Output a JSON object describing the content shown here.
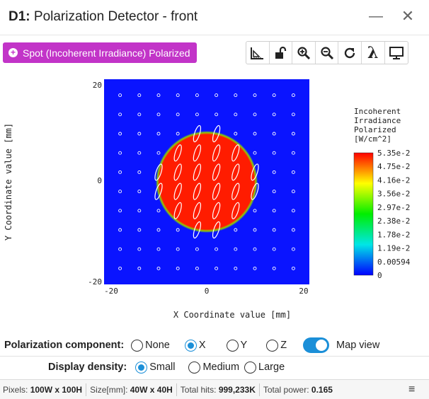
{
  "window": {
    "id": "D1:",
    "title": " Polarization Detector - front",
    "minimize_glyph": "—",
    "close_glyph": "✕"
  },
  "source_button": {
    "label": "Spot (Incoherent Irradiance) Polarized",
    "icon": "plus-circle-icon"
  },
  "toolbar": {
    "tools": [
      "ruler-icon",
      "unlock-icon",
      "zoom-in-icon",
      "zoom-out-icon",
      "refresh-icon",
      "lambda-icon",
      "monitor-icon"
    ],
    "lambda_glyph": "λ"
  },
  "colors": {
    "accent": "#c234c8",
    "toggle": "#1b8fd8",
    "plot_background": "#0a14ff",
    "spot": "#ff1c00"
  },
  "chart_data": {
    "type": "heatmap",
    "xlabel": "X Coordinate value [mm]",
    "ylabel": "Y Coordinate value [mm]",
    "xlim": [
      -20,
      20
    ],
    "ylim": [
      -20,
      20
    ],
    "x_ticks": [
      "-20",
      "0",
      "20"
    ],
    "y_ticks": [
      "20",
      "0",
      "-20"
    ],
    "spot": {
      "center": [
        0,
        0
      ],
      "radius_mm": 10
    },
    "colorbar": {
      "title": [
        "Incoherent",
        "Irradiance",
        "Polarized",
        "[W/cm^2]"
      ],
      "ticks": [
        "5.35e-2",
        "4.75e-2",
        "4.16e-2",
        "3.56e-2",
        "2.97e-2",
        "2.38e-2",
        "1.78e-2",
        "1.19e-2",
        "0.00594",
        "0"
      ]
    },
    "polarization_grid": {
      "columns": 10,
      "rows": 10,
      "x_start": -18,
      "y_start": 18,
      "step": 4
    }
  },
  "controls": {
    "polarization": {
      "label": "Polarization component:",
      "options": [
        "None",
        "X",
        "Y",
        "Z"
      ],
      "selected": "X",
      "map_view_label": "Map view",
      "map_view_on": true
    },
    "density": {
      "label": "Display density:",
      "options": [
        "Small",
        "Medium",
        "Large"
      ],
      "selected": "Small"
    }
  },
  "status": {
    "pixels_label": "Pixels: ",
    "pixels_value": "100W x 100H",
    "size_label": "Size[mm]: ",
    "size_value": "40W x 40H",
    "hits_label": "Total hits: ",
    "hits_value": "999,233K",
    "power_label": "Total power: ",
    "power_value": "0.165",
    "menu_glyph": "≡"
  }
}
